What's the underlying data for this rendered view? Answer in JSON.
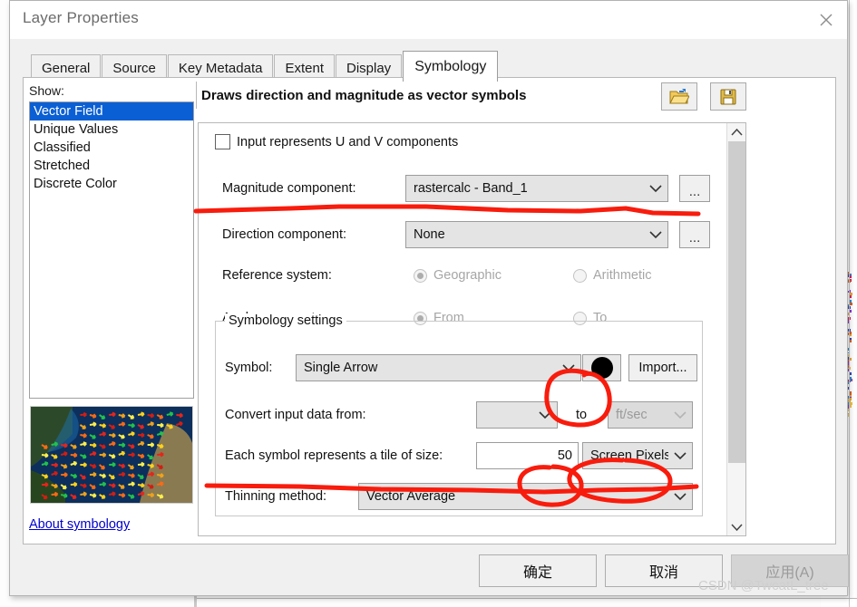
{
  "window": {
    "title": "Layer Properties",
    "close_icon": "close-icon"
  },
  "tabs": [
    {
      "label": "General",
      "active": false
    },
    {
      "label": "Source",
      "active": false
    },
    {
      "label": "Key Metadata",
      "active": false
    },
    {
      "label": "Extent",
      "active": false
    },
    {
      "label": "Display",
      "active": false
    },
    {
      "label": "Symbology",
      "active": true
    }
  ],
  "sidebar": {
    "show_label": "Show:",
    "items": [
      {
        "label": "Vector Field",
        "selected": true
      },
      {
        "label": "Unique Values",
        "selected": false
      },
      {
        "label": "Classified",
        "selected": false
      },
      {
        "label": "Stretched",
        "selected": false
      },
      {
        "label": "Discrete Color",
        "selected": false
      }
    ],
    "preview_name": "vector-field-preview",
    "about_link": "About symbology"
  },
  "panel": {
    "description": "Draws direction and magnitude as vector symbols",
    "open_icon": "open-folder-icon",
    "save_icon": "save-disk-icon"
  },
  "form": {
    "uv_checkbox": {
      "label": "Input represents U and V components",
      "checked": false
    },
    "magnitude": {
      "label": "Magnitude component:",
      "value": "rastercalc - Band_1",
      "browse_label": "..."
    },
    "direction": {
      "label": "Direction component:",
      "value": "None",
      "browse_label": "..."
    },
    "reference_system": {
      "label": "Reference system:",
      "options": [
        {
          "label": "Geographic",
          "selected": true
        },
        {
          "label": "Arithmetic",
          "selected": false
        }
      ]
    },
    "angle_represents": {
      "label": "Angle represents:",
      "options": [
        {
          "label": "From",
          "selected": true
        },
        {
          "label": "To",
          "selected": false
        }
      ]
    }
  },
  "symbology_settings": {
    "group_title": "Symbology settings",
    "symbol": {
      "label": "Symbol:",
      "value": "Single Arrow",
      "color": "#000000",
      "import_label": "Import..."
    },
    "convert": {
      "label": "Convert input data from:",
      "from_value": "",
      "to_label": "to",
      "to_value": "ft/sec"
    },
    "tile_size": {
      "label": "Each symbol represents a tile of size:",
      "value": "50",
      "unit": "Screen Pixels"
    },
    "thinning": {
      "label": "Thinning method:",
      "value": "Vector Average"
    }
  },
  "scrollbar": {
    "up_icon": "chevron-up-icon",
    "down_icon": "chevron-down-icon"
  },
  "footer": {
    "ok_label": "确定",
    "cancel_label": "取消",
    "apply_label": "应用(A)",
    "apply_disabled": true
  },
  "watermark": "CSDN @TwcatL_tree",
  "colors": {
    "accent_selected": "#0b5fd4",
    "annotation_ink": "#f81c0d",
    "link": "#0000d0"
  }
}
